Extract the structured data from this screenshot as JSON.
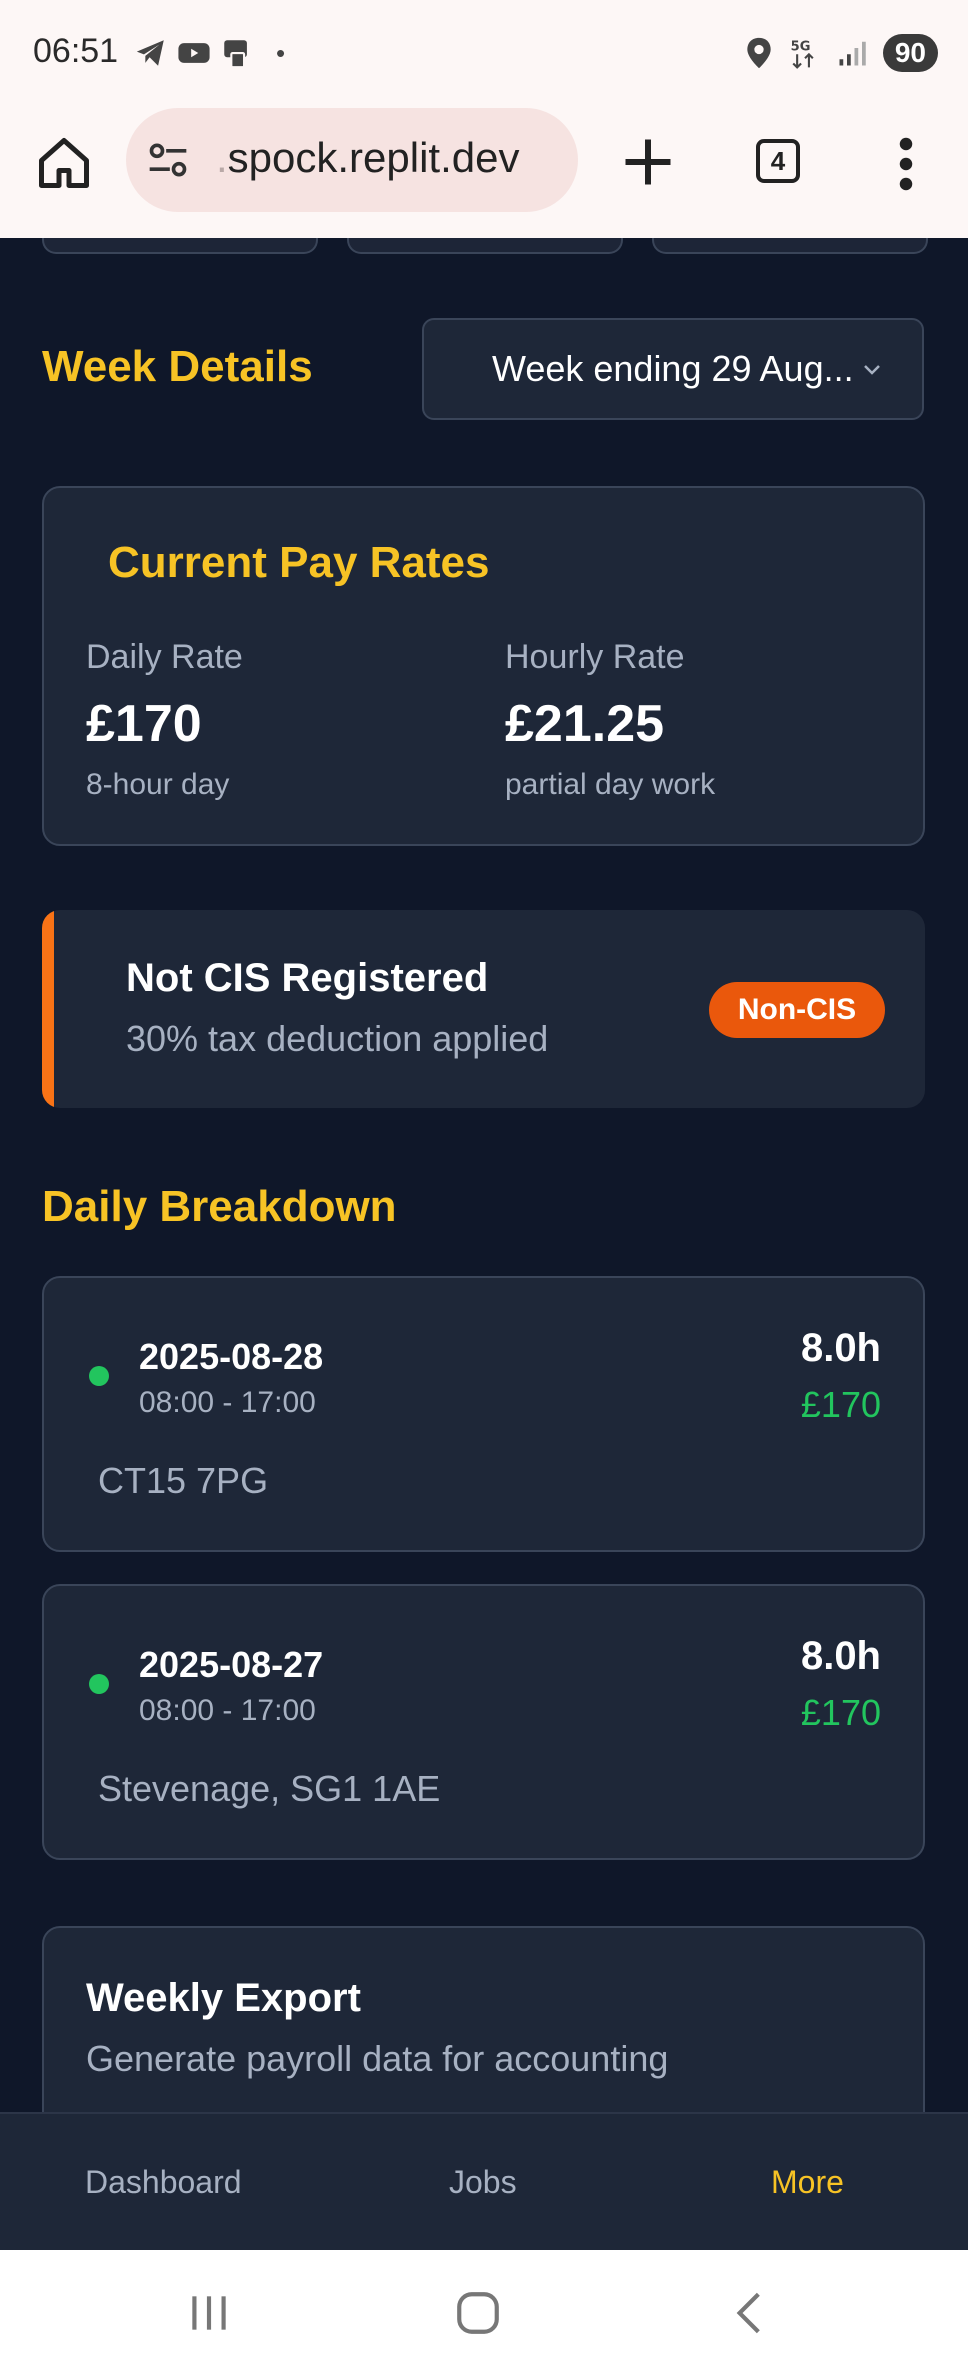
{
  "status_bar": {
    "time": "06:51",
    "dot": "•",
    "battery": "90",
    "icons_left": [
      "telegram-icon",
      "youtube-icon",
      "app-icon"
    ],
    "icons_right": [
      "location-icon",
      "5g-icon",
      "signal-icon"
    ]
  },
  "browser": {
    "url_dot": ".",
    "url": "spock.replit.dev",
    "tab_count": "4"
  },
  "week_details": {
    "title": "Week Details",
    "selected_week": "Week ending 29 Aug..."
  },
  "pay_rates": {
    "title": "Current Pay Rates",
    "daily_label": "Daily Rate",
    "daily_value": "£170",
    "daily_note": "8-hour day",
    "hourly_label": "Hourly Rate",
    "hourly_value": "£21.25",
    "hourly_note": "partial day work"
  },
  "cis": {
    "title": "Not CIS Registered",
    "subtitle": "30% tax deduction applied",
    "badge": "Non-CIS",
    "accent_color": "#f97316"
  },
  "daily_breakdown": {
    "title": "Daily Breakdown",
    "days": [
      {
        "date": "2025-08-28",
        "time": "08:00 - 17:00",
        "hours": "8.0h",
        "pay": "£170",
        "location": "CT15 7PG"
      },
      {
        "date": "2025-08-27",
        "time": "08:00 - 17:00",
        "hours": "8.0h",
        "pay": "£170",
        "location": "Stevenage, SG1 1AE"
      }
    ]
  },
  "export": {
    "title": "Weekly Export",
    "subtitle": "Generate payroll data for accounting"
  },
  "bottom_nav": {
    "items": [
      {
        "label": "Dashboard"
      },
      {
        "label": "Jobs"
      },
      {
        "label": "More"
      }
    ],
    "active_color": "#f7c325"
  },
  "theme": {
    "background": "#0f1729",
    "card": "#1e2738",
    "accent_yellow": "#f7c325",
    "success_green": "#22c55e"
  }
}
